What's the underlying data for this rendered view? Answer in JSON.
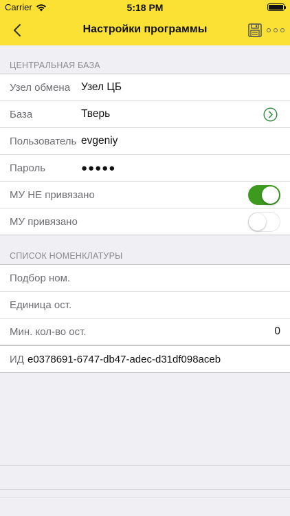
{
  "status_bar": {
    "carrier": "Carrier",
    "time": "5:18 PM"
  },
  "nav": {
    "title": "Настройки программы",
    "back_icon": "chevron-left-icon",
    "save_icon": "floppy-disk-icon",
    "more_icon": "more-dots-icon"
  },
  "central_base": {
    "header": "ЦЕНТРАЛЬНАЯ БАЗА",
    "rows": [
      {
        "label": "Узел обмена",
        "value": "Узел ЦБ"
      },
      {
        "label": "База",
        "value": "Тверь"
      },
      {
        "label": "Пользователь",
        "value": "evgeniy"
      },
      {
        "label": "Пароль",
        "value": "●●●●●"
      },
      {
        "label": "МУ НЕ привязано",
        "toggle": true
      },
      {
        "label": "МУ привязано",
        "toggle": false
      }
    ]
  },
  "nomenclature": {
    "header": "СПИСОК НОМЕНКЛАТУРЫ",
    "rows": [
      {
        "label": "Подбор ном.",
        "value": ""
      },
      {
        "label": "Единица ост.",
        "value": ""
      },
      {
        "label": "Мин. кол-во ост.",
        "value": "0"
      }
    ]
  },
  "id_row": {
    "label": "ИД",
    "value": "e0378691-6747-db47-adec-d31df098aceb"
  },
  "colors": {
    "accent_yellow": "#fbe134",
    "toggle_on": "#3c9b1f",
    "chevron_green": "#2e8b3a"
  }
}
